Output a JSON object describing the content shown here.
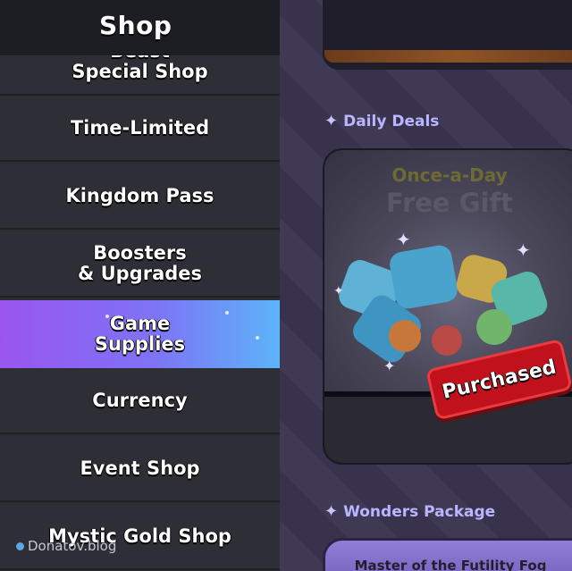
{
  "sidebar": {
    "title": "Shop",
    "items": [
      {
        "label": "Beast\nSpecial Shop",
        "active": false
      },
      {
        "label": "Time-Limited",
        "active": false
      },
      {
        "label": "Kingdom Pass",
        "active": false
      },
      {
        "label": "Boosters\n& Upgrades",
        "active": false
      },
      {
        "label": "Game\nSupplies",
        "active": true
      },
      {
        "label": "Currency",
        "active": false
      },
      {
        "label": "Event Shop",
        "active": false
      },
      {
        "label": "Mystic Gold Shop",
        "active": false
      }
    ]
  },
  "watermark": "Donatov.blog",
  "content": {
    "daily_deals_label": "Daily Deals",
    "gift_card": {
      "subtitle": "Once-a-Day",
      "title": "Free Gift",
      "badge": "Purchased"
    },
    "wonders_label": "Wonders Package",
    "package_title": "Master of the Futility Fog"
  },
  "colors": {
    "active_gradient_start": "#9a55f0",
    "active_gradient_end": "#5cb4f9",
    "badge_red": "#c0111d",
    "section_label": "#b9b6ff"
  },
  "icons": {
    "section_star": "four-point-star-icon",
    "watermark": "dot-icon"
  }
}
